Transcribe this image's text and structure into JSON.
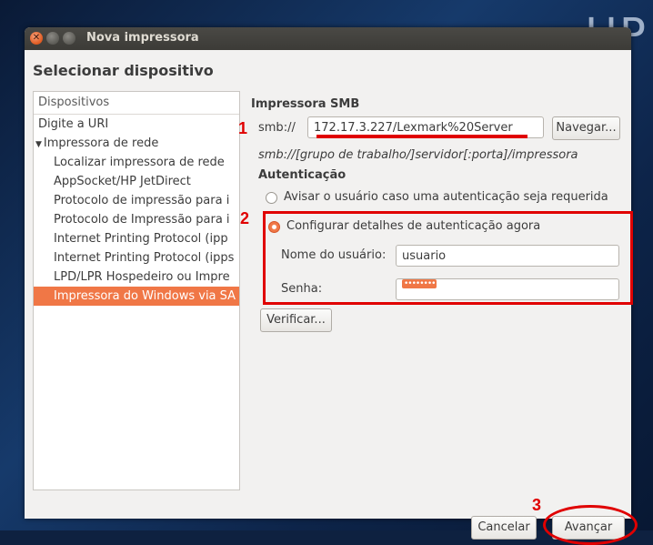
{
  "window": {
    "title": "Nova impressora"
  },
  "heading": "Selecionar dispositivo",
  "devices": {
    "header": "Dispositivos",
    "items": [
      {
        "label": "Digite a URI"
      },
      {
        "label": "Impressora de rede"
      },
      {
        "label": "Localizar impressora de rede"
      },
      {
        "label": "AppSocket/HP JetDirect"
      },
      {
        "label": "Protocolo de impressão para i"
      },
      {
        "label": "Protocolo de Impressão para i"
      },
      {
        "label": "Internet Printing Protocol (ipp"
      },
      {
        "label": "Internet Printing Protocol (ipps"
      },
      {
        "label": "LPD/LPR Hospedeiro ou Impre"
      },
      {
        "label": "Impressora do Windows via SA"
      }
    ],
    "selected_index": 9
  },
  "smb": {
    "section_title": "Impressora SMB",
    "prefix": "smb://",
    "uri_value": "172.17.3.227/Lexmark%20Server",
    "browse_label": "Navegar...",
    "format_hint": "smb://[grupo de trabalho/]servidor[:porta]/impressora"
  },
  "auth": {
    "section_title": "Autenticação",
    "option_prompt": "Avisar o usuário caso uma autenticação seja requerida",
    "option_now": "Configurar detalhes de autenticação agora",
    "selected_option": "option_now",
    "username_label": "Nome do usuário:",
    "username_value": "usuario",
    "password_label": "Senha:",
    "password_mask": "••••••••",
    "verify_label": "Verificar..."
  },
  "footer": {
    "cancel_label": "Cancelar",
    "next_label": "Avançar"
  },
  "annotations": {
    "step1": "1",
    "step2": "2",
    "step3": "3",
    "color": "#e00000"
  },
  "colors": {
    "accent": "#f07746",
    "titlebar": "#3c3b37"
  },
  "background_text": "HP"
}
